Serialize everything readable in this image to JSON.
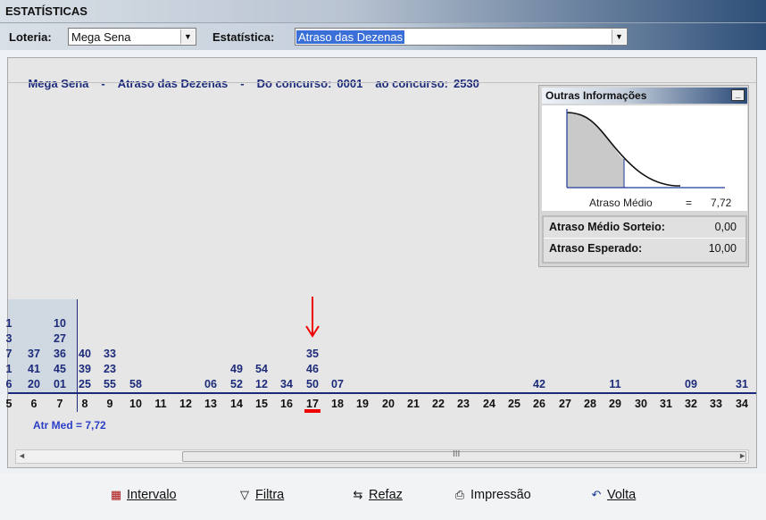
{
  "window": {
    "title": "ESTATÍSTICAS"
  },
  "toolbar": {
    "loteria_label": "Loteria:",
    "loteria_value": "Mega Sena",
    "estatistica_label": "Estatística:",
    "estatistica_value": "Atraso das Dezenas"
  },
  "headline": {
    "lottery": "Mega Sena",
    "dash1": "-",
    "stat": "Atraso das Dezenas",
    "dash2": "-",
    "from_label": "Do concurso:",
    "from_value": "0001",
    "to_label": "ao concurso:",
    "to_value": "2530"
  },
  "info": {
    "title": "Outras Informações",
    "minimize": "_",
    "atraso_medio_label": "Atraso Médio",
    "atraso_medio_eq": "=",
    "atraso_medio_value": "7,72",
    "medio_sorteio_label": "Atraso Médio Sorteio:",
    "medio_sorteio_value": "0,00",
    "esperado_label": "Atraso Esperado:",
    "esperado_value": "10,00"
  },
  "chart": {
    "columns": [
      "5",
      "6",
      "7",
      "8",
      "9",
      "10",
      "11",
      "12",
      "13",
      "14",
      "15",
      "16",
      "17",
      "18",
      "19",
      "20",
      "21",
      "22",
      "23",
      "24",
      "25",
      "26",
      "27",
      "28",
      "29",
      "30",
      "31",
      "32",
      "33",
      "34"
    ],
    "stacks": [
      [
        "1",
        "3",
        "7",
        "1",
        "6"
      ],
      [
        "",
        "",
        "37",
        "41",
        "20"
      ],
      [
        "10",
        "27",
        "36",
        "45",
        "01"
      ],
      [
        "",
        "",
        "40",
        "39",
        "25"
      ],
      [
        "",
        "",
        "33",
        "23",
        "55"
      ],
      [
        "",
        "",
        "",
        "",
        "58"
      ],
      [
        "",
        "",
        "",
        "",
        ""
      ],
      [
        "",
        "",
        "",
        "",
        ""
      ],
      [
        "",
        "",
        "",
        "",
        "06"
      ],
      [
        "",
        "",
        "",
        "49",
        "52"
      ],
      [
        "",
        "",
        "",
        "54",
        "12"
      ],
      [
        "",
        "",
        "",
        "",
        "34"
      ],
      [
        "",
        "",
        "35",
        "46",
        "50"
      ],
      [
        "",
        "",
        "",
        "",
        "07"
      ],
      [
        "",
        "",
        "",
        "",
        ""
      ],
      [
        "",
        "",
        "",
        "",
        ""
      ],
      [
        "",
        "",
        "",
        "",
        ""
      ],
      [
        "",
        "",
        "",
        "",
        ""
      ],
      [
        "",
        "",
        "",
        "",
        ""
      ],
      [
        "",
        "",
        "",
        "",
        ""
      ],
      [
        "",
        "",
        "",
        "",
        ""
      ],
      [
        "",
        "",
        "",
        "",
        "42"
      ],
      [
        "",
        "",
        "",
        "",
        ""
      ],
      [
        "",
        "",
        "",
        "",
        ""
      ],
      [
        "",
        "",
        "",
        "",
        "11"
      ],
      [
        "",
        "",
        "",
        "",
        ""
      ],
      [
        "",
        "",
        "",
        "",
        ""
      ],
      [
        "",
        "",
        "",
        "",
        "09"
      ],
      [
        "",
        "",
        "",
        "",
        ""
      ],
      [
        "",
        "",
        "",
        "",
        "31"
      ]
    ],
    "highlight_column": "17",
    "atr_med": "Atr Med = 7,72"
  },
  "scrollbar": {
    "left_arrow": "◄",
    "right_arrow": "►",
    "grip": "III"
  },
  "footer": {
    "buttons": [
      {
        "name": "intervalo",
        "icon": "range-icon",
        "label": "Intervalo"
      },
      {
        "name": "filtra",
        "icon": "filter-icon",
        "label": "Filtra"
      },
      {
        "name": "refaz",
        "icon": "redo-icon",
        "label": "Refaz"
      },
      {
        "name": "impressao",
        "icon": "printer-icon",
        "label": "Impressão"
      },
      {
        "name": "volta",
        "icon": "back-icon",
        "label": "Volta"
      }
    ]
  }
}
